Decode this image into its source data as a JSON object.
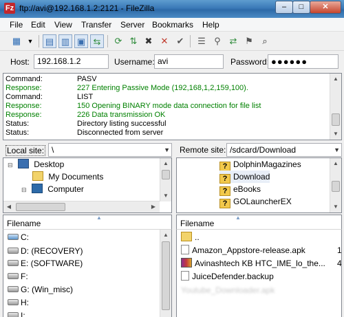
{
  "window": {
    "title": "ftp://avi@192.168.1.2:2121 - FileZilla",
    "app_icon": "Fz",
    "buttons": [
      "–",
      "□",
      "✕"
    ]
  },
  "menu": [
    "File",
    "Edit",
    "View",
    "Transfer",
    "Server",
    "Bookmarks",
    "Help"
  ],
  "toolbar": {
    "icons": [
      "site-manager-icon",
      "toggle-log-icon",
      "toggle-tree-icon",
      "toggle-remote-tree-icon",
      "toggle-queue-icon",
      "refresh-icon",
      "process-queue-icon",
      "cancel-icon",
      "disconnect-icon",
      "reconnect-icon",
      "directory-listing-icon",
      "filter-icon",
      "compare-icon",
      "sync-browse-icon",
      "search-icon"
    ]
  },
  "quickconnect": {
    "host_label": "Host:",
    "host": "192.168.1.2",
    "user_label": "Username:",
    "user": "avi",
    "pass_label": "Password:",
    "pass": "●●●●●●"
  },
  "log": [
    {
      "type": "Command:",
      "msg": "PASV",
      "green": false
    },
    {
      "type": "Response:",
      "msg": "227 Entering Passive Mode (192,168,1,2,159,100).",
      "green": true
    },
    {
      "type": "Command:",
      "msg": "LIST",
      "green": false
    },
    {
      "type": "Response:",
      "msg": "150 Opening BINARY mode data connection for file list",
      "green": true
    },
    {
      "type": "Response:",
      "msg": "226 Data transmission OK",
      "green": true
    },
    {
      "type": "Status:",
      "msg": "Directory listing successful",
      "green": false
    },
    {
      "type": "Status:",
      "msg": "Disconnected from server",
      "green": false
    }
  ],
  "local": {
    "label": "Local site:",
    "path": "\\",
    "tree": [
      "Desktop",
      "My Documents",
      "Computer"
    ],
    "header": "Filename",
    "files": [
      "C:",
      "D: (RECOVERY)",
      "E: (SOFTWARE)",
      "F:",
      "G: (Win_misc)",
      "H:",
      "I:"
    ]
  },
  "remote": {
    "label": "Remote site:",
    "path": "/sdcard/Download",
    "tree": [
      "DolphinMagazines",
      "Download",
      "eBooks",
      "GOLauncherEX"
    ],
    "header": "Filename",
    "files": [
      {
        "name": "..",
        "size": ""
      },
      {
        "name": "Amazon_Appstore-release.apk",
        "size": "1,"
      },
      {
        "name": "Avinashtech KB HTC_IME_lo_the...",
        "size": "4,"
      },
      {
        "name": "JuiceDefender.backup",
        "size": ""
      },
      {
        "name": "Youtube_Downloader.apk",
        "size": ""
      }
    ]
  }
}
